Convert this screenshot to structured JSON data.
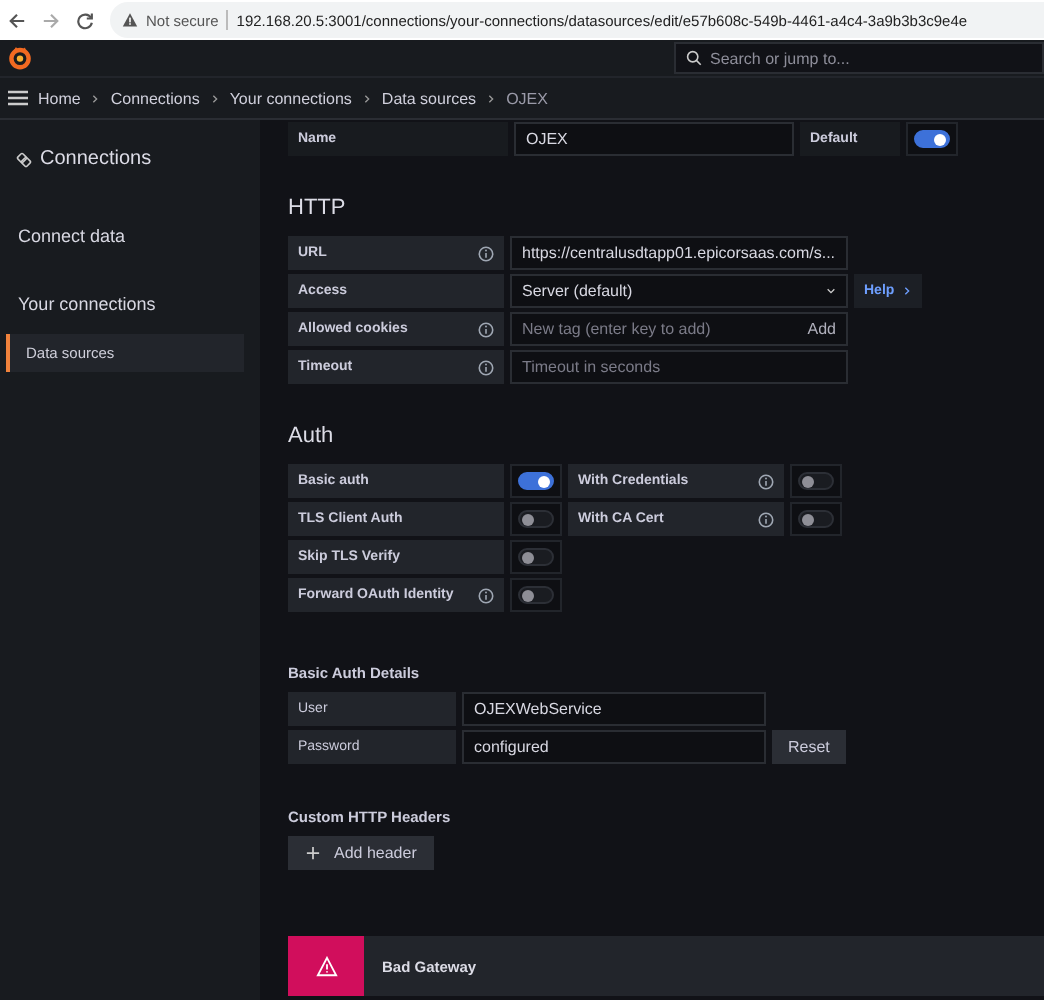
{
  "browser": {
    "security": "Not secure",
    "url": "192.168.20.5:3001/connections/your-connections/datasources/edit/e57b608c-549b-4461-a4c4-3a9b3b3c9e4e"
  },
  "topbar": {
    "search_placeholder": "Search or jump to..."
  },
  "breadcrumbs": [
    {
      "label": "Home",
      "current": false
    },
    {
      "label": "Connections",
      "current": false
    },
    {
      "label": "Your connections",
      "current": false
    },
    {
      "label": "Data sources",
      "current": false
    },
    {
      "label": "OJEX",
      "current": true
    }
  ],
  "sidebar": {
    "title": "Connections",
    "items": [
      {
        "label": "Connect data",
        "selected": false
      },
      {
        "label": "Your connections",
        "selected": false,
        "children": [
          {
            "label": "Data sources",
            "selected": true
          }
        ]
      }
    ]
  },
  "name_row": {
    "label": "Name",
    "value": "OJEX",
    "default_label": "Default",
    "default_on": true
  },
  "http": {
    "title": "HTTP",
    "fields": [
      {
        "label": "URL",
        "kind": "text",
        "info": true,
        "value": "https://centralusdtapp01.epicorsaas.com/s..."
      },
      {
        "label": "Access",
        "kind": "select",
        "info": false,
        "value": "Server (default)",
        "help": "Help"
      },
      {
        "label": "Allowed cookies",
        "kind": "tags",
        "info": true,
        "placeholder": "New tag (enter key to add)",
        "add": "Add"
      },
      {
        "label": "Timeout",
        "kind": "text",
        "info": true,
        "placeholder": "Timeout in seconds"
      }
    ]
  },
  "auth": {
    "title": "Auth",
    "rows": [
      {
        "left": {
          "label": "Basic auth",
          "info": false,
          "on": true
        },
        "right": {
          "label": "With Credentials",
          "info": true,
          "on": false
        }
      },
      {
        "left": {
          "label": "TLS Client Auth",
          "info": false,
          "on": false
        },
        "right": {
          "label": "With CA Cert",
          "info": true,
          "on": false
        }
      },
      {
        "left": {
          "label": "Skip TLS Verify",
          "info": false,
          "on": false
        }
      },
      {
        "left": {
          "label": "Forward OAuth Identity",
          "info": true,
          "on": false
        }
      }
    ]
  },
  "basic_auth_details": {
    "title": "Basic Auth Details",
    "user": {
      "label": "User",
      "value": "OJEXWebService"
    },
    "password": {
      "label": "Password",
      "value": "configured",
      "reset": "Reset"
    }
  },
  "custom_headers": {
    "title": "Custom HTTP Headers",
    "add_button": "Add header"
  },
  "alert": {
    "kind": "error",
    "title": "Bad Gateway"
  }
}
